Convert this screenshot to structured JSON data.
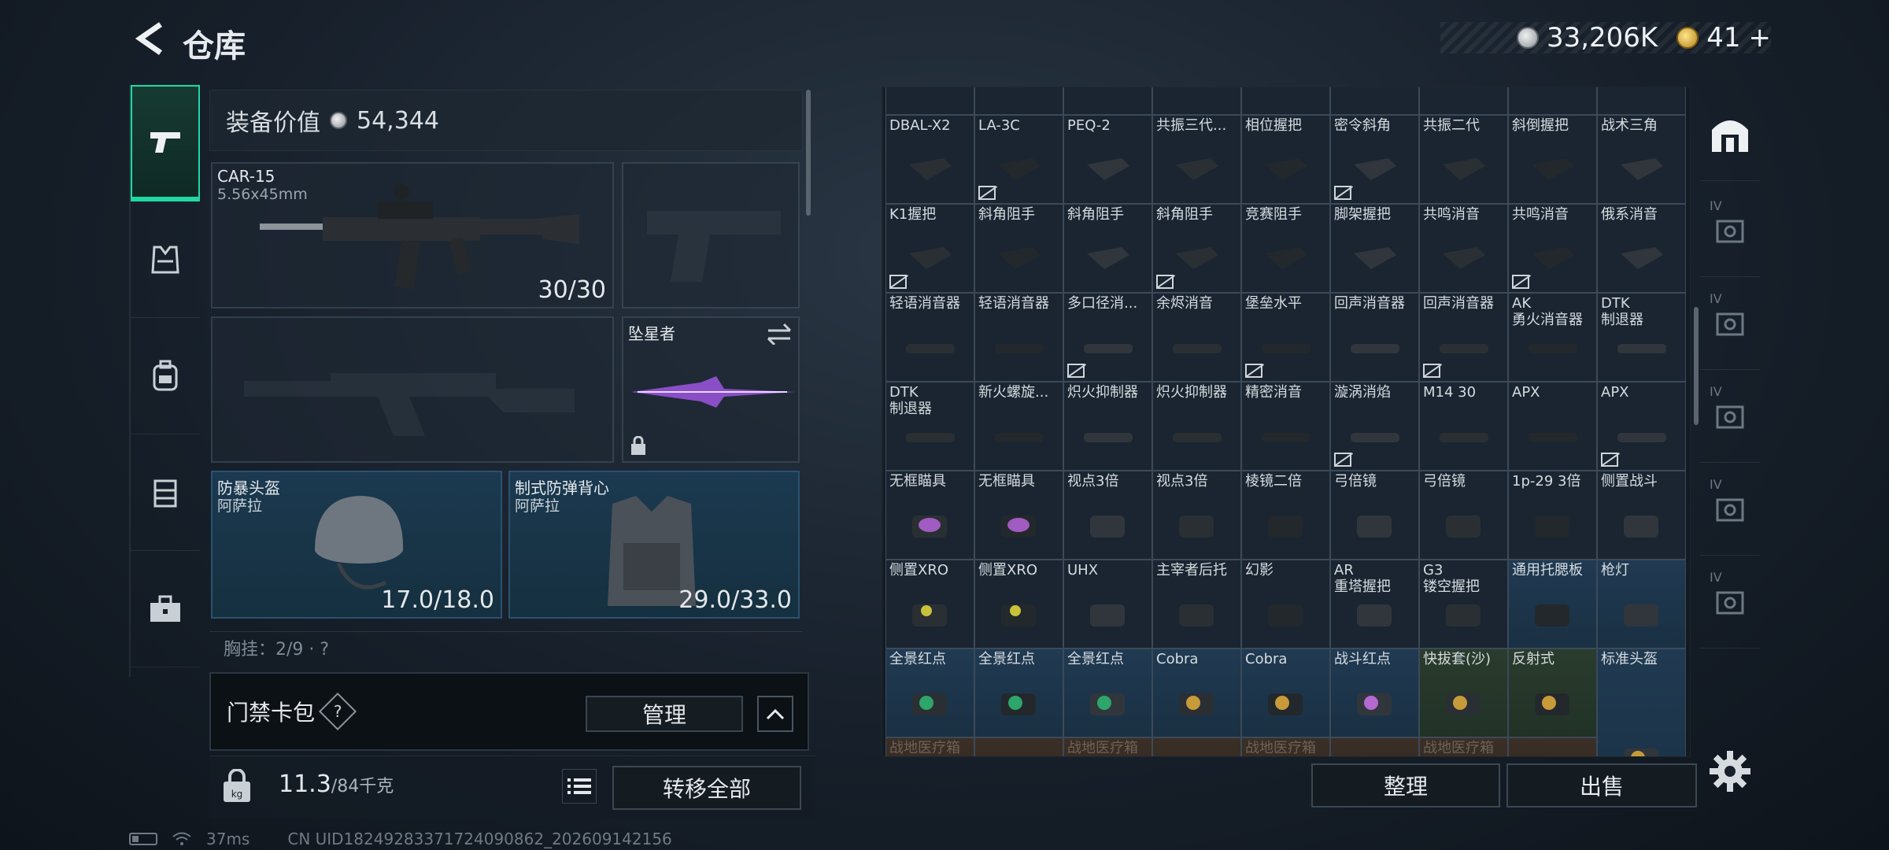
{
  "header": {
    "title": "仓库",
    "silver_value": "33,206K",
    "gold_value": "41",
    "gold_plus": "+"
  },
  "loadout": {
    "value_label": "装备价值",
    "value_amount": "54,344",
    "primary": {
      "name": "CAR-15",
      "caliber": "5.56x45mm",
      "ammo": "30/30"
    },
    "melee": {
      "name": "坠星者"
    },
    "helmet": {
      "name": "防暴头盔",
      "source": "阿萨拉",
      "durability": "17.0/18.0"
    },
    "vest": {
      "name": "制式防弹背心",
      "source": "阿萨拉",
      "durability": "29.0/33.0"
    },
    "chest_rig": "胸挂：2/9 · ?"
  },
  "keycard": {
    "label": "门禁卡包",
    "help": "?",
    "manage": "管理"
  },
  "bottom": {
    "weight": "11.3",
    "weight_max": "/84千克",
    "transfer_all": "转移全部"
  },
  "status": {
    "ping": "37ms",
    "uid": "CN UID18249283371724090862_202609142156"
  },
  "storage": {
    "rows": [
      [
        {
          "name": "DBAL-X2",
          "tier": "dark",
          "nocase": false
        },
        {
          "name": "LA-3C",
          "tier": "dark",
          "nocase": true
        },
        {
          "name": "PEQ-2",
          "tier": "dark",
          "nocase": false
        },
        {
          "name": "共振三代...",
          "tier": "dark",
          "nocase": false
        },
        {
          "name": "相位握把",
          "tier": "dark",
          "nocase": false
        },
        {
          "name": "密令斜角",
          "tier": "dark",
          "nocase": true
        },
        {
          "name": "共振二代",
          "tier": "dark",
          "nocase": false
        },
        {
          "name": "斜倒握把",
          "tier": "dark",
          "nocase": false
        },
        {
          "name": "战术三角",
          "tier": "dark",
          "nocase": false
        }
      ],
      [
        {
          "name": "K1握把",
          "tier": "dark",
          "nocase": true
        },
        {
          "name": "斜角阻手",
          "tier": "dark",
          "nocase": false
        },
        {
          "name": "斜角阻手",
          "tier": "dark",
          "nocase": false
        },
        {
          "name": "斜角阻手",
          "tier": "dark",
          "nocase": true
        },
        {
          "name": "竞赛阻手",
          "tier": "dark",
          "nocase": false
        },
        {
          "name": "脚架握把",
          "tier": "dark",
          "nocase": false
        },
        {
          "name": "共鸣消音",
          "tier": "dark",
          "nocase": false
        },
        {
          "name": "共鸣消音",
          "tier": "dark",
          "nocase": true
        },
        {
          "name": "俄系消音",
          "tier": "dark",
          "nocase": false
        }
      ],
      [
        {
          "name": "轻语消音器",
          "tier": "dark",
          "nocase": false
        },
        {
          "name": "轻语消音器",
          "tier": "dark",
          "nocase": false
        },
        {
          "name": "多口径消...",
          "tier": "dark",
          "nocase": true
        },
        {
          "name": "余烬消音",
          "tier": "dark",
          "nocase": false
        },
        {
          "name": "堡垒水平",
          "tier": "dark",
          "nocase": true
        },
        {
          "name": "回声消音器",
          "tier": "dark",
          "nocase": false
        },
        {
          "name": "回声消音器",
          "tier": "dark",
          "nocase": true
        },
        {
          "name": "AK\n勇火消音器",
          "tier": "dark",
          "nocase": false
        },
        {
          "name": "DTK\n制退器",
          "tier": "dark",
          "nocase": false
        }
      ],
      [
        {
          "name": "DTK\n制退器",
          "tier": "dark",
          "nocase": false
        },
        {
          "name": "新火螺旋...",
          "tier": "dark",
          "nocase": false
        },
        {
          "name": "炽火抑制器",
          "tier": "dark",
          "nocase": false
        },
        {
          "name": "炽火抑制器",
          "tier": "dark",
          "nocase": false
        },
        {
          "name": "精密消音",
          "tier": "dark",
          "nocase": false
        },
        {
          "name": "漩涡消焰",
          "tier": "dark",
          "nocase": true
        },
        {
          "name": "M14 30",
          "tier": "dark",
          "nocase": false
        },
        {
          "name": "APX",
          "tier": "dark",
          "nocase": false
        },
        {
          "name": "APX",
          "tier": "dark",
          "nocase": true
        }
      ],
      [
        {
          "name": "无框瞄具",
          "tier": "dark",
          "nocase": false
        },
        {
          "name": "无框瞄具",
          "tier": "dark",
          "nocase": false
        },
        {
          "name": "视点3倍",
          "tier": "dark",
          "nocase": false
        },
        {
          "name": "视点3倍",
          "tier": "dark",
          "nocase": false
        },
        {
          "name": "棱镜二倍",
          "tier": "dark",
          "nocase": false
        },
        {
          "name": "弓倍镜",
          "tier": "dark",
          "nocase": false
        },
        {
          "name": "弓倍镜",
          "tier": "dark",
          "nocase": false
        },
        {
          "name": "1p-29 3倍",
          "tier": "dark",
          "nocase": false
        },
        {
          "name": "侧置战斗",
          "tier": "dark",
          "nocase": false
        }
      ],
      [
        {
          "name": "侧置XRO",
          "tier": "dark",
          "nocase": false
        },
        {
          "name": "侧置XRO",
          "tier": "dark",
          "nocase": false
        },
        {
          "name": "UHX",
          "tier": "dark",
          "nocase": false
        },
        {
          "name": "主宰者后托",
          "tier": "dark",
          "nocase": false
        },
        {
          "name": "幻影",
          "tier": "dark",
          "nocase": false
        },
        {
          "name": "AR\n重塔握把",
          "tier": "dark",
          "nocase": false
        },
        {
          "name": "G3\n镂空握把",
          "tier": "dark",
          "nocase": false
        },
        {
          "name": "通用托腮板",
          "tier": "blue",
          "nocase": false
        },
        {
          "name": "枪灯",
          "tier": "blue",
          "nocase": false
        }
      ],
      [
        {
          "name": "全景红点",
          "tier": "blue",
          "nocase": false
        },
        {
          "name": "全景红点",
          "tier": "blue",
          "nocase": false
        },
        {
          "name": "全景红点",
          "tier": "blue",
          "nocase": false
        },
        {
          "name": "Cobra",
          "tier": "blue",
          "nocase": false
        },
        {
          "name": "Cobra",
          "tier": "blue",
          "nocase": false
        },
        {
          "name": "战斗红点",
          "tier": "blue",
          "nocase": false
        },
        {
          "name": "快拔套(沙)",
          "tier": "green",
          "nocase": false
        },
        {
          "name": "反射式",
          "tier": "green",
          "nocase": false
        },
        {
          "name": "标准头盔",
          "tier": "blue",
          "nocase": false
        }
      ],
      [
        {
          "name": "战地医疗箱",
          "tier": "gold",
          "nocase": false
        },
        {
          "name": "",
          "tier": "gold",
          "nocase": false
        },
        {
          "name": "战地医疗箱",
          "tier": "gold",
          "nocase": false
        },
        {
          "name": "",
          "tier": "gold",
          "nocase": false
        },
        {
          "name": "战地医疗箱",
          "tier": "gold",
          "nocase": false
        },
        {
          "name": "",
          "tier": "gold",
          "nocase": false
        },
        {
          "name": "战地医疗箱",
          "tier": "gold",
          "nocase": false
        },
        {
          "name": "",
          "tier": "gold",
          "nocase": false
        }
      ]
    ],
    "tidy": "整理",
    "sell": "出售"
  },
  "right_tabs": [
    "IV",
    "IV",
    "IV",
    "IV",
    "IV"
  ],
  "colors": {
    "accent": "#1fd9a4",
    "blue_tier": "#203a52",
    "panel": "#1a2531"
  }
}
